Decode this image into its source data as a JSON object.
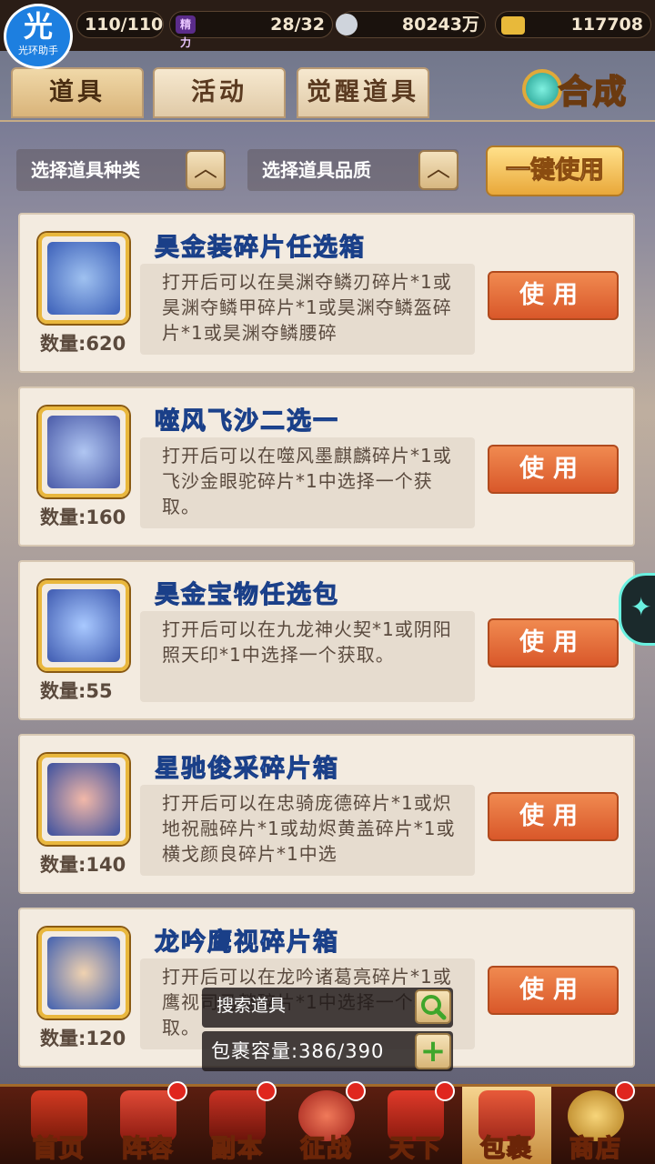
{
  "app": {
    "logo_glyph": "光",
    "logo_text": "光环助手"
  },
  "status": {
    "stamina": "110/110",
    "energy_label": "精力",
    "energy": "28/32",
    "silver": "80243万",
    "gold": "117708"
  },
  "tabs": [
    {
      "label": "道具",
      "active": true
    },
    {
      "label": "活动",
      "active": false
    },
    {
      "label": "觉醒道具",
      "active": false
    }
  ],
  "compose_label": "合成",
  "filters": {
    "type_label": "选择道具种类",
    "quality_label": "选择道具品质",
    "onekey_label": "一键使用"
  },
  "items": [
    {
      "title": "昊金装碎片任选箱",
      "count": "数量:620",
      "desc": "打开后可以在昊渊夺鳞刃碎片*1或昊渊夺鳞甲碎片*1或昊渊夺鳞盔碎片*1或昊渊夺鳞腰碎",
      "use_label": "使用",
      "icon_color": "#3b5fb8"
    },
    {
      "title": "噬风飞沙二选一",
      "count": "数量:160",
      "desc": "打开后可以在噬风墨麒麟碎片*1或飞沙金眼驼碎片*1中选择一个获取。",
      "use_label": "使用",
      "icon_color": "#4a5aa8"
    },
    {
      "title": "昊金宝物任选包",
      "count": "数量:55",
      "desc": "打开后可以在九龙神火契*1或阴阳照天印*1中选择一个获取。",
      "use_label": "使用",
      "icon_color": "#3e5ab0"
    },
    {
      "title": "星驰俊采碎片箱",
      "count": "数量:140",
      "desc": "打开后可以在忠骑庞德碎片*1或炽地祝融碎片*1或劫烬黄盖碎片*1或横戈颜良碎片*1中选",
      "use_label": "使用",
      "icon_color": "#3a4f9e"
    },
    {
      "title": "龙吟鹰视碎片箱",
      "count": "数量:120",
      "desc": "打开后可以在龙吟诸葛亮碎片*1或鹰视司马懿碎片*1中选择一个获取。",
      "use_label": "使用",
      "icon_color": "#4160b0"
    }
  ],
  "search": {
    "label": "搜索道具"
  },
  "capacity": {
    "label": "包裹容量:386/390"
  },
  "nav": [
    {
      "label": "首页",
      "badge": false,
      "active": false
    },
    {
      "label": "阵容",
      "badge": true,
      "active": false
    },
    {
      "label": "副本",
      "badge": true,
      "active": false
    },
    {
      "label": "征战",
      "badge": true,
      "active": false
    },
    {
      "label": "天下",
      "badge": true,
      "active": false
    },
    {
      "label": "包裹",
      "badge": false,
      "active": true
    },
    {
      "label": "商店",
      "badge": true,
      "active": false
    }
  ]
}
